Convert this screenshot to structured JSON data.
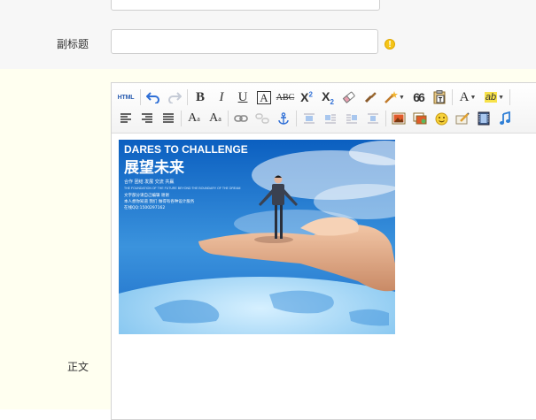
{
  "form": {
    "subtitle_label": "副标题",
    "subtitle_value": "",
    "subtitle_warning_glyph": "!",
    "body_label": "正文"
  },
  "toolbar": {
    "row1": [
      {
        "name": "html-source-button",
        "icon": "html-icon",
        "label": "HTML"
      },
      {
        "name": "undo-button",
        "icon": "undo-icon"
      },
      {
        "name": "redo-button",
        "icon": "redo-icon"
      },
      {
        "name": "bold-button",
        "icon": "bold-icon",
        "label": "B"
      },
      {
        "name": "italic-button",
        "icon": "italic-icon",
        "label": "I"
      },
      {
        "name": "underline-button",
        "icon": "underline-icon",
        "label": "U"
      },
      {
        "name": "font-border-button",
        "icon": "font-border-icon",
        "label": "A"
      },
      {
        "name": "strikethrough-button",
        "icon": "strikethrough-icon",
        "label": "ABC"
      },
      {
        "name": "superscript-button",
        "icon": "superscript-icon",
        "label": "X",
        "sup": "2"
      },
      {
        "name": "subscript-button",
        "icon": "subscript-icon",
        "label": "X",
        "sub": "2"
      },
      {
        "name": "remove-format-button",
        "icon": "eraser-icon"
      },
      {
        "name": "format-painter-button",
        "icon": "brush-icon"
      },
      {
        "name": "auto-typeset-button",
        "icon": "magic-wand-icon"
      },
      {
        "name": "blockquote-button",
        "icon": "quote-icon",
        "label": "66"
      },
      {
        "name": "paste-plain-button",
        "icon": "paste-text-icon"
      },
      {
        "name": "font-color-button",
        "icon": "font-color-icon",
        "label": "A"
      },
      {
        "name": "highlight-color-button",
        "icon": "highlight-icon",
        "label": "ab"
      }
    ],
    "row2": [
      {
        "name": "align-left-button",
        "icon": "align-left-icon"
      },
      {
        "name": "align-right-button",
        "icon": "align-right-icon"
      },
      {
        "name": "align-justify-button",
        "icon": "align-justify-icon"
      },
      {
        "name": "indent-button",
        "icon": "indent-icon",
        "label": "A"
      },
      {
        "name": "outdent-button",
        "icon": "outdent-icon",
        "label": "A"
      },
      {
        "name": "insert-link-button",
        "icon": "link-icon"
      },
      {
        "name": "unlink-button",
        "icon": "unlink-icon"
      },
      {
        "name": "anchor-button",
        "icon": "anchor-icon"
      },
      {
        "name": "image-float-none-button",
        "icon": "image-none-icon"
      },
      {
        "name": "image-float-left-button",
        "icon": "image-left-icon"
      },
      {
        "name": "image-float-right-button",
        "icon": "image-right-icon"
      },
      {
        "name": "image-center-button",
        "icon": "image-center-icon"
      },
      {
        "name": "insert-image-button",
        "icon": "image-icon"
      },
      {
        "name": "insert-multi-image-button",
        "icon": "multi-image-icon"
      },
      {
        "name": "emoticon-button",
        "icon": "smiley-icon"
      },
      {
        "name": "scrawl-button",
        "icon": "scrawl-icon"
      },
      {
        "name": "insert-video-button",
        "icon": "video-icon"
      },
      {
        "name": "insert-music-button",
        "icon": "music-icon"
      }
    ]
  },
  "content_image": {
    "headline_en": "DARES TO CHALLENGE",
    "headline_cn": "展望未来",
    "tagline": "合作  团结  发展  交流  共赢",
    "small_text_1": "THE FOUNDATION OF THE FUTURE BEYOND THE BOUNDARY OF THE DREAM",
    "small_text_2": "文字部分请自己编辑 谢谢",
    "small_text_3": "本人想你知道 我们 做得有各种设计服务",
    "small_text_4": "在线QQ:1500297162"
  },
  "colors": {
    "accent_blue": "#1565c0",
    "undo_blue": "#2f6fd6",
    "warning_yellow": "#f5c518",
    "body_bg": "#fffff0",
    "form_bg": "#f7f7f7"
  }
}
